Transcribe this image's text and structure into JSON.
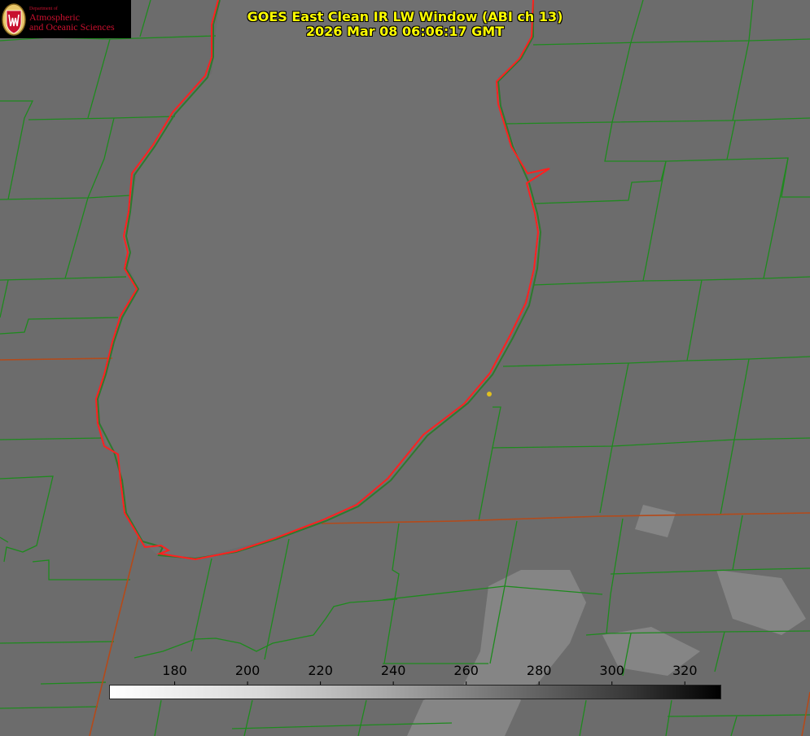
{
  "logo": {
    "department": "Department of",
    "line1": "Atmospheric",
    "line2": "and Oceanic Sciences"
  },
  "title": {
    "line1": "GOES East Clean IR LW Window (ABI ch 13)",
    "line2": "2026 Mar 08 06:06:17 GMT"
  },
  "colorbar": {
    "min": 162,
    "max": 330,
    "ticks": [
      {
        "label": "180",
        "value": 180
      },
      {
        "label": "200",
        "value": 200
      },
      {
        "label": "220",
        "value": 220
      },
      {
        "label": "240",
        "value": 240
      },
      {
        "label": "260",
        "value": 260
      },
      {
        "label": "280",
        "value": 280
      },
      {
        "label": "300",
        "value": 300
      },
      {
        "label": "320",
        "value": 320
      }
    ]
  },
  "colors": {
    "background": "#6e6e6e",
    "lake": "#707070",
    "county_lines": "#1e8a1e",
    "state_lines": "#b44a1a",
    "shoreline": "#ff2020",
    "title": "#ffff00",
    "marker": "#e0c020"
  }
}
